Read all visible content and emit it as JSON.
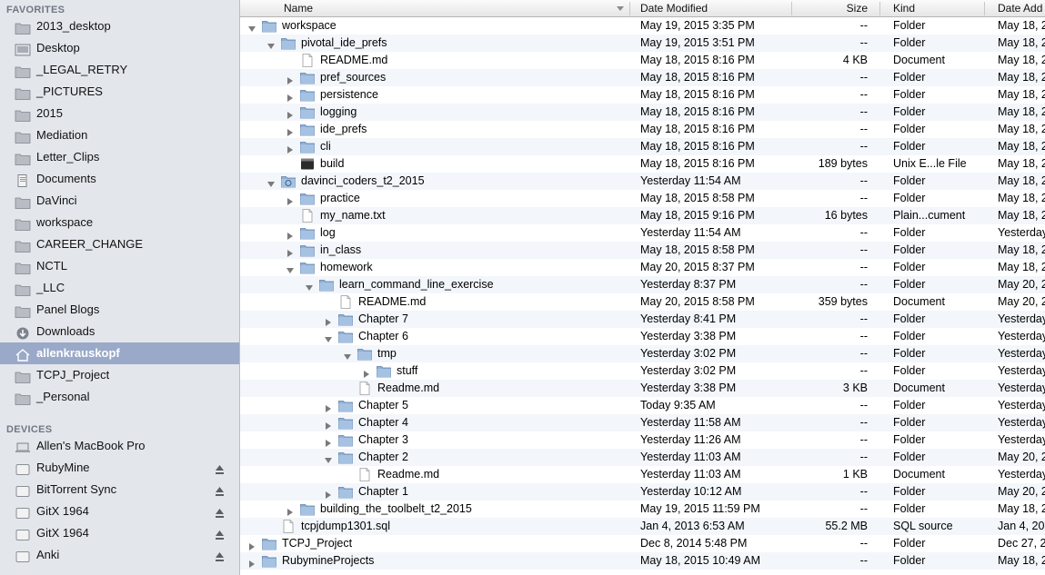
{
  "sidebar": {
    "favorites_header": "FAVORITES",
    "favorites": [
      {
        "label": "2013_desktop",
        "icon": "folder-icon"
      },
      {
        "label": "Desktop",
        "icon": "desktop-icon"
      },
      {
        "label": "_LEGAL_RETRY",
        "icon": "folder-icon"
      },
      {
        "label": "_PICTURES",
        "icon": "folder-icon"
      },
      {
        "label": "2015",
        "icon": "folder-icon"
      },
      {
        "label": "Mediation",
        "icon": "folder-icon"
      },
      {
        "label": "Letter_Clips",
        "icon": "folder-icon"
      },
      {
        "label": "Documents",
        "icon": "documents-icon"
      },
      {
        "label": "DaVinci",
        "icon": "folder-icon"
      },
      {
        "label": "workspace",
        "icon": "folder-icon"
      },
      {
        "label": "CAREER_CHANGE",
        "icon": "folder-icon"
      },
      {
        "label": "NCTL",
        "icon": "folder-icon"
      },
      {
        "label": "_LLC",
        "icon": "folder-icon"
      },
      {
        "label": "Panel Blogs",
        "icon": "folder-icon"
      },
      {
        "label": "Downloads",
        "icon": "downloads-icon"
      },
      {
        "label": "allenkrauskopf",
        "icon": "home-icon",
        "selected": true
      },
      {
        "label": "TCPJ_Project",
        "icon": "folder-icon"
      },
      {
        "label": "_Personal",
        "icon": "folder-icon"
      }
    ],
    "devices_header": "DEVICES",
    "devices": [
      {
        "label": "Allen's MacBook Pro",
        "icon": "laptop-icon",
        "eject": false
      },
      {
        "label": "RubyMine",
        "icon": "disk-icon",
        "eject": true
      },
      {
        "label": "BitTorrent Sync",
        "icon": "disk-icon",
        "eject": true
      },
      {
        "label": "GitX 1964",
        "icon": "disk-icon",
        "eject": true
      },
      {
        "label": "GitX 1964",
        "icon": "disk-icon",
        "eject": true
      },
      {
        "label": "Anki",
        "icon": "disk-icon",
        "eject": true
      }
    ]
  },
  "columns": {
    "name": "Name",
    "date_modified": "Date Modified",
    "size": "Size",
    "kind": "Kind",
    "date_added": "Date Add"
  },
  "rows": [
    {
      "depth": 0,
      "disclosure": "open",
      "icon": "folder",
      "name": "workspace",
      "date": "May 19, 2015 3:35 PM",
      "size": "--",
      "kind": "Folder",
      "added": "May 18, 2"
    },
    {
      "depth": 1,
      "disclosure": "open",
      "icon": "folder",
      "name": "pivotal_ide_prefs",
      "date": "May 19, 2015 3:51 PM",
      "size": "--",
      "kind": "Folder",
      "added": "May 18, 2"
    },
    {
      "depth": 2,
      "disclosure": "none",
      "icon": "file",
      "name": "README.md",
      "date": "May 18, 2015 8:16 PM",
      "size": "4 KB",
      "kind": "Document",
      "added": "May 18, 2"
    },
    {
      "depth": 2,
      "disclosure": "closed",
      "icon": "folder",
      "name": "pref_sources",
      "date": "May 18, 2015 8:16 PM",
      "size": "--",
      "kind": "Folder",
      "added": "May 18, 2"
    },
    {
      "depth": 2,
      "disclosure": "closed",
      "icon": "folder",
      "name": "persistence",
      "date": "May 18, 2015 8:16 PM",
      "size": "--",
      "kind": "Folder",
      "added": "May 18, 2"
    },
    {
      "depth": 2,
      "disclosure": "closed",
      "icon": "folder",
      "name": "logging",
      "date": "May 18, 2015 8:16 PM",
      "size": "--",
      "kind": "Folder",
      "added": "May 18, 2"
    },
    {
      "depth": 2,
      "disclosure": "closed",
      "icon": "folder",
      "name": "ide_prefs",
      "date": "May 18, 2015 8:16 PM",
      "size": "--",
      "kind": "Folder",
      "added": "May 18, 2"
    },
    {
      "depth": 2,
      "disclosure": "closed",
      "icon": "folder",
      "name": "cli",
      "date": "May 18, 2015 8:16 PM",
      "size": "--",
      "kind": "Folder",
      "added": "May 18, 2"
    },
    {
      "depth": 2,
      "disclosure": "none",
      "icon": "exec",
      "name": "build",
      "date": "May 18, 2015 8:16 PM",
      "size": "189 bytes",
      "kind": "Unix E...le File",
      "added": "May 18, 2"
    },
    {
      "depth": 1,
      "disclosure": "open",
      "icon": "sync-folder",
      "name": "davinci_coders_t2_2015",
      "date": "Yesterday 11:54 AM",
      "size": "--",
      "kind": "Folder",
      "added": "May 18, 2"
    },
    {
      "depth": 2,
      "disclosure": "closed",
      "icon": "folder",
      "name": "practice",
      "date": "May 18, 2015 8:58 PM",
      "size": "--",
      "kind": "Folder",
      "added": "May 18, 2"
    },
    {
      "depth": 2,
      "disclosure": "none",
      "icon": "file",
      "name": "my_name.txt",
      "date": "May 18, 2015 9:16 PM",
      "size": "16 bytes",
      "kind": "Plain...cument",
      "added": "May 18, 2"
    },
    {
      "depth": 2,
      "disclosure": "closed",
      "icon": "folder",
      "name": "log",
      "date": "Yesterday 11:54 AM",
      "size": "--",
      "kind": "Folder",
      "added": "Yesterday"
    },
    {
      "depth": 2,
      "disclosure": "closed",
      "icon": "folder",
      "name": "in_class",
      "date": "May 18, 2015 8:58 PM",
      "size": "--",
      "kind": "Folder",
      "added": "May 18, 2"
    },
    {
      "depth": 2,
      "disclosure": "open",
      "icon": "folder",
      "name": "homework",
      "date": "May 20, 2015 8:37 PM",
      "size": "--",
      "kind": "Folder",
      "added": "May 18, 2"
    },
    {
      "depth": 3,
      "disclosure": "open",
      "icon": "folder",
      "name": "learn_command_line_exercise",
      "date": "Yesterday 8:37 PM",
      "size": "--",
      "kind": "Folder",
      "added": "May 20, 2"
    },
    {
      "depth": 4,
      "disclosure": "none",
      "icon": "file",
      "name": "README.md",
      "date": "May 20, 2015 8:58 PM",
      "size": "359 bytes",
      "kind": "Document",
      "added": "May 20, 2"
    },
    {
      "depth": 4,
      "disclosure": "closed",
      "icon": "folder",
      "name": "Chapter 7",
      "date": "Yesterday 8:41 PM",
      "size": "--",
      "kind": "Folder",
      "added": "Yesterday"
    },
    {
      "depth": 4,
      "disclosure": "open",
      "icon": "folder",
      "name": "Chapter 6",
      "date": "Yesterday 3:38 PM",
      "size": "--",
      "kind": "Folder",
      "added": "Yesterday"
    },
    {
      "depth": 5,
      "disclosure": "open",
      "icon": "folder",
      "name": "tmp",
      "date": "Yesterday 3:02 PM",
      "size": "--",
      "kind": "Folder",
      "added": "Yesterday"
    },
    {
      "depth": 6,
      "disclosure": "closed",
      "icon": "folder",
      "name": "stuff",
      "date": "Yesterday 3:02 PM",
      "size": "--",
      "kind": "Folder",
      "added": "Yesterday"
    },
    {
      "depth": 5,
      "disclosure": "none",
      "icon": "file",
      "name": "Readme.md",
      "date": "Yesterday 3:38 PM",
      "size": "3 KB",
      "kind": "Document",
      "added": "Yesterday"
    },
    {
      "depth": 4,
      "disclosure": "closed",
      "icon": "folder",
      "name": "Chapter 5",
      "date": "Today 9:35 AM",
      "size": "--",
      "kind": "Folder",
      "added": "Yesterday"
    },
    {
      "depth": 4,
      "disclosure": "closed",
      "icon": "folder",
      "name": "Chapter 4",
      "date": "Yesterday 11:58 AM",
      "size": "--",
      "kind": "Folder",
      "added": "Yesterday"
    },
    {
      "depth": 4,
      "disclosure": "closed",
      "icon": "folder",
      "name": "Chapter 3",
      "date": "Yesterday 11:26 AM",
      "size": "--",
      "kind": "Folder",
      "added": "Yesterday"
    },
    {
      "depth": 4,
      "disclosure": "open",
      "icon": "folder",
      "name": "Chapter 2",
      "date": "Yesterday 11:03 AM",
      "size": "--",
      "kind": "Folder",
      "added": "May 20, 2"
    },
    {
      "depth": 5,
      "disclosure": "none",
      "icon": "file",
      "name": "Readme.md",
      "date": "Yesterday 11:03 AM",
      "size": "1 KB",
      "kind": "Document",
      "added": "Yesterday"
    },
    {
      "depth": 4,
      "disclosure": "closed",
      "icon": "folder",
      "name": "Chapter 1",
      "date": "Yesterday 10:12 AM",
      "size": "--",
      "kind": "Folder",
      "added": "May 20, 2"
    },
    {
      "depth": 2,
      "disclosure": "closed",
      "icon": "folder",
      "name": "building_the_toolbelt_t2_2015",
      "date": "May 19, 2015 11:59 PM",
      "size": "--",
      "kind": "Folder",
      "added": "May 18, 2"
    },
    {
      "depth": 1,
      "disclosure": "none",
      "icon": "file",
      "name": "tcpjdump1301.sql",
      "date": "Jan 4, 2013 6:53 AM",
      "size": "55.2 MB",
      "kind": "SQL source",
      "added": "Jan 4, 20"
    },
    {
      "depth": 0,
      "disclosure": "closed",
      "icon": "folder",
      "name": "TCPJ_Project",
      "date": "Dec 8, 2014 5:48 PM",
      "size": "--",
      "kind": "Folder",
      "added": "Dec 27, 2"
    },
    {
      "depth": 0,
      "disclosure": "closed",
      "icon": "folder",
      "name": "RubymineProjects",
      "date": "May 18, 2015 10:49 AM",
      "size": "--",
      "kind": "Folder",
      "added": "May 18, 2"
    }
  ]
}
